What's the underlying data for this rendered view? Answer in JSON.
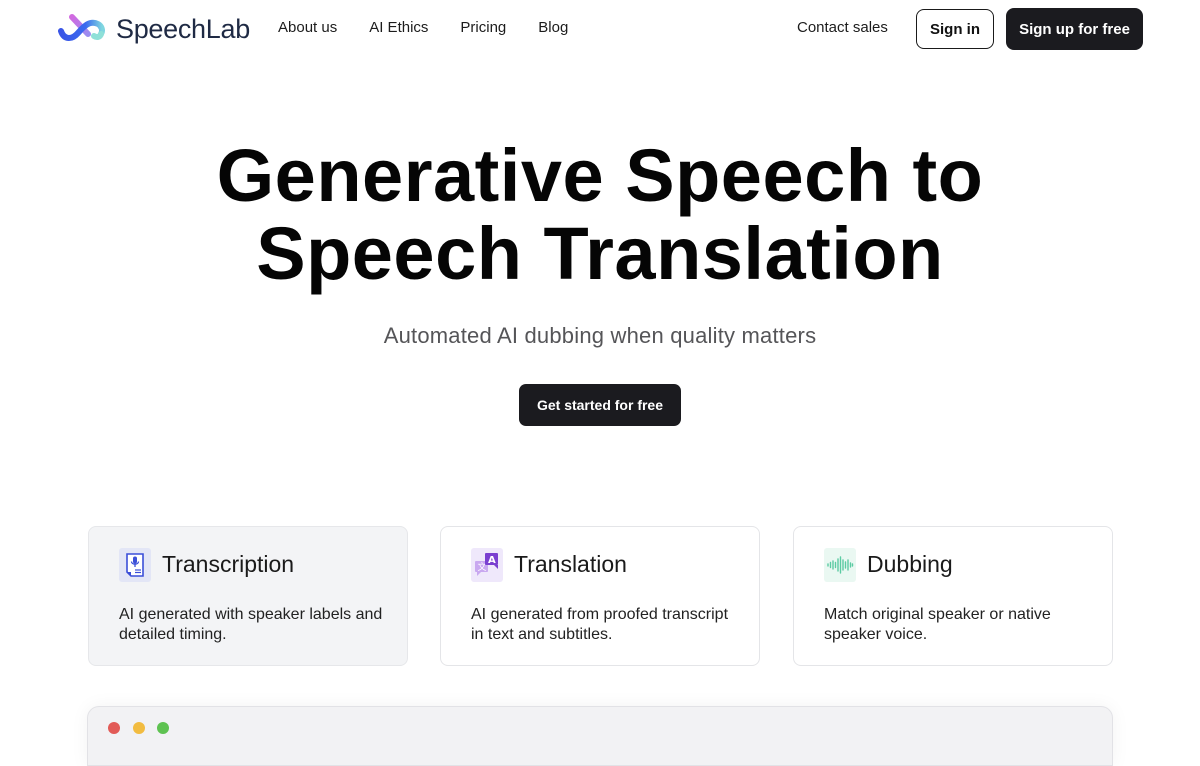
{
  "brand": {
    "name": "SpeechLab",
    "logo_icon": "infinity-wave-icon"
  },
  "nav": {
    "links": [
      {
        "label": "About us"
      },
      {
        "label": "AI Ethics"
      },
      {
        "label": "Pricing"
      },
      {
        "label": "Blog"
      }
    ],
    "contact_sales": "Contact sales",
    "sign_in": "Sign in",
    "sign_up": "Sign up for free"
  },
  "hero": {
    "title_line1": "Generative Speech to",
    "title_line2": "Speech Translation",
    "subtitle": "Automated AI dubbing when quality matters",
    "cta": "Get started for free"
  },
  "features": [
    {
      "title": "Transcription",
      "description": "AI generated with speaker labels and detailed timing.",
      "icon": "transcript-document-mic-icon",
      "active": true,
      "accent": "#3b4fd8"
    },
    {
      "title": "Translation",
      "description": "AI generated from proofed transcript in text and subtitles.",
      "icon": "translate-icon",
      "active": false,
      "accent": "#7a3fd0"
    },
    {
      "title": "Dubbing",
      "description": "Match original speaker or native speaker voice.",
      "icon": "sound-wave-icon",
      "active": false,
      "accent": "#5ccba3"
    }
  ],
  "preview_window": {
    "controls": [
      "close",
      "minimize",
      "maximize"
    ]
  }
}
